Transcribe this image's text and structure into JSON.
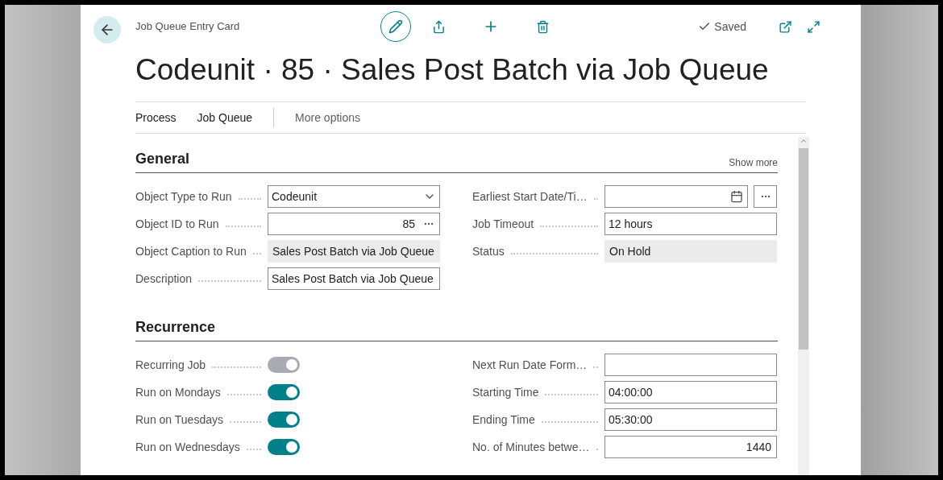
{
  "page": {
    "breadcrumb": "Job Queue Entry Card",
    "title": "Codeunit · 85 · Sales Post Batch via Job Queue",
    "status": "Saved"
  },
  "actions": [
    "Process",
    "Job Queue"
  ],
  "more_options": "More options",
  "sections": [
    {
      "title": "General",
      "show_more": "Show more",
      "columns": [
        [
          {
            "label": "Object Type to Run",
            "kind": "select",
            "value": "Codeunit"
          },
          {
            "label": "Object ID to Run",
            "kind": "lookup",
            "value": "85"
          },
          {
            "label": "Object Caption to Run",
            "kind": "readonly",
            "value": "Sales Post Batch via Job Queue"
          },
          {
            "label": "Description",
            "kind": "text",
            "value": "Sales Post Batch via Job Queue"
          }
        ],
        [
          {
            "label": "Earliest Start Date/Ti…",
            "kind": "date"
          },
          {
            "label": "Job Timeout",
            "kind": "text",
            "value": "12 hours"
          },
          {
            "label": "Status",
            "kind": "readonly",
            "value": "On Hold"
          }
        ]
      ]
    },
    {
      "title": "Recurrence",
      "columns": [
        [
          {
            "label": "Recurring Job",
            "kind": "toggle",
            "on": true,
            "disabled": true
          },
          {
            "label": "Run on Mondays",
            "kind": "toggle",
            "on": true,
            "disabled": false
          },
          {
            "label": "Run on Tuesdays",
            "kind": "toggle",
            "on": true,
            "disabled": false
          },
          {
            "label": "Run on Wednesdays",
            "kind": "toggle",
            "on": true,
            "disabled": false
          }
        ],
        [
          {
            "label": "Next Run Date Form…",
            "kind": "text"
          },
          {
            "label": "Starting Time",
            "kind": "text",
            "value": "04:00:00"
          },
          {
            "label": "Ending Time",
            "kind": "text",
            "value": "05:30:00"
          },
          {
            "label": "No. of Minutes betwe…",
            "kind": "number",
            "value": "1440"
          }
        ]
      ]
    }
  ]
}
